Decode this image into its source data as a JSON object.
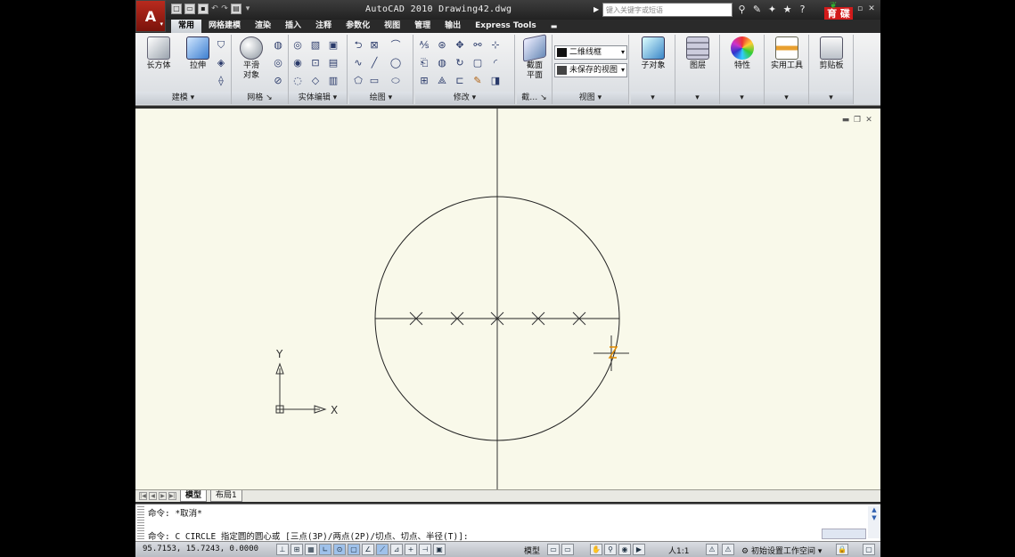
{
  "title_bar": {
    "app_button_glyph": "A",
    "title": "AutoCAD 2010  Drawing42.dwg",
    "search_placeholder": "键入关键字或短语",
    "logo_text": "育 碟\n教 育"
  },
  "tabs": [
    "常用",
    "网格建模",
    "渲染",
    "插入",
    "注释",
    "参数化",
    "视图",
    "管理",
    "输出",
    "Express Tools"
  ],
  "active_tab": "常用",
  "ribbon": {
    "modeling": {
      "label": "建模",
      "box": "长方体",
      "extrude": "拉伸"
    },
    "mesh": {
      "label": "网格",
      "smooth": "平滑\n对象"
    },
    "solid_edit": {
      "label": "实体编辑"
    },
    "draw": {
      "label": "绘图"
    },
    "modify": {
      "label": "修改"
    },
    "section": {
      "label": "截…",
      "plane": "截面\n平面"
    },
    "view": {
      "label": "视图",
      "visual_style": "二维线框",
      "saved_view": "未保存的视图"
    },
    "subobject": {
      "label": "子对象"
    },
    "layers": {
      "label": "图层"
    },
    "properties": {
      "label": "特性"
    },
    "utilities": {
      "label": "实用工具"
    },
    "clipboard": {
      "label": "剪贴板"
    }
  },
  "drawing": {
    "background": "#f9f9ea",
    "ucs_x": "X",
    "ucs_y": "Y"
  },
  "layout_tabs": {
    "model": "模型",
    "layout1": "布局1"
  },
  "command_line": {
    "history": "命令: *取消*",
    "prompt": "命令: C CIRCLE 指定圆的圆心或 [三点(3P)/两点(2P)/切点、切点、半径(T)]:"
  },
  "status_bar": {
    "coordinates": "95.7153,  15.7243, 0.0000",
    "model_label": "模型",
    "annotation_scale": "人1:1",
    "workspace": "初始设置工作空间"
  }
}
